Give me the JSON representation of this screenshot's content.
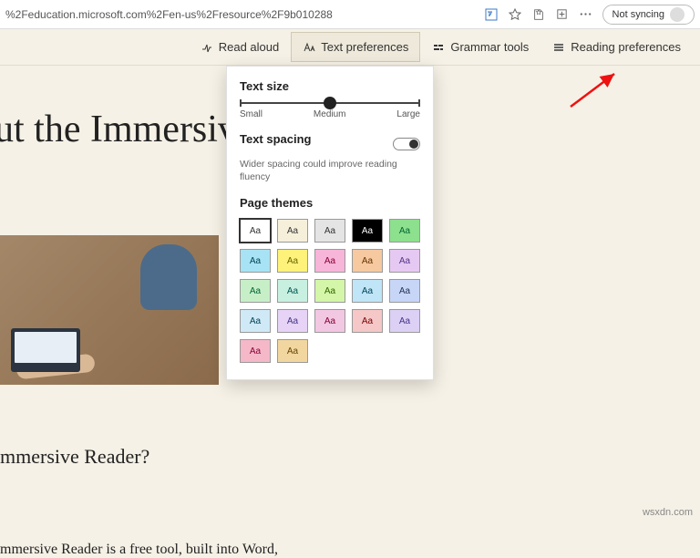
{
  "addr": {
    "url": "%2Feducation.microsoft.com%2Fen-us%2Fresource%2F9b010288",
    "sync": "Not syncing"
  },
  "toolbar": {
    "read_aloud": "Read aloud",
    "text_prefs": "Text preferences",
    "grammar": "Grammar tools",
    "reading_prefs": "Reading preferences"
  },
  "page": {
    "headline": "ut the Immersiv",
    "sub1": "mmersive Reader?",
    "sub2": "mmersive Reader is a free tool, built into Word,"
  },
  "panel": {
    "text_size_label": "Text size",
    "slider": {
      "small": "Small",
      "medium": "Medium",
      "large": "Large"
    },
    "text_spacing_label": "Text spacing",
    "text_spacing_desc": "Wider spacing could improve reading fluency",
    "page_themes_label": "Page themes",
    "swatch_text": "Aa",
    "themes": [
      {
        "bg": "#ffffff",
        "fg": "#333",
        "sel": true
      },
      {
        "bg": "#f6f0db",
        "fg": "#333"
      },
      {
        "bg": "#e4e4e4",
        "fg": "#333"
      },
      {
        "bg": "#000000",
        "fg": "#fff"
      },
      {
        "bg": "#8de08d",
        "fg": "#063"
      },
      {
        "bg": "#a7e3f4",
        "fg": "#045"
      },
      {
        "bg": "#fff27a",
        "fg": "#660"
      },
      {
        "bg": "#f7b5d9",
        "fg": "#803"
      },
      {
        "bg": "#f6c9a0",
        "fg": "#630"
      },
      {
        "bg": "#e6c9f2",
        "fg": "#538"
      },
      {
        "bg": "#c7efc7",
        "fg": "#063"
      },
      {
        "bg": "#c8f0e0",
        "fg": "#055"
      },
      {
        "bg": "#d4f6a8",
        "fg": "#360"
      },
      {
        "bg": "#bfe5f7",
        "fg": "#045"
      },
      {
        "bg": "#c7d6f7",
        "fg": "#235"
      },
      {
        "bg": "#cfe9f7",
        "fg": "#045"
      },
      {
        "bg": "#e6d3f5",
        "fg": "#438"
      },
      {
        "bg": "#f2c7e2",
        "fg": "#803"
      },
      {
        "bg": "#f5c7c7",
        "fg": "#700"
      },
      {
        "bg": "#dcd0f5",
        "fg": "#438"
      },
      {
        "bg": "#f5b8c9",
        "fg": "#803"
      },
      {
        "bg": "#f2d6a0",
        "fg": "#640"
      }
    ]
  },
  "watermark": "wsxdn.com"
}
